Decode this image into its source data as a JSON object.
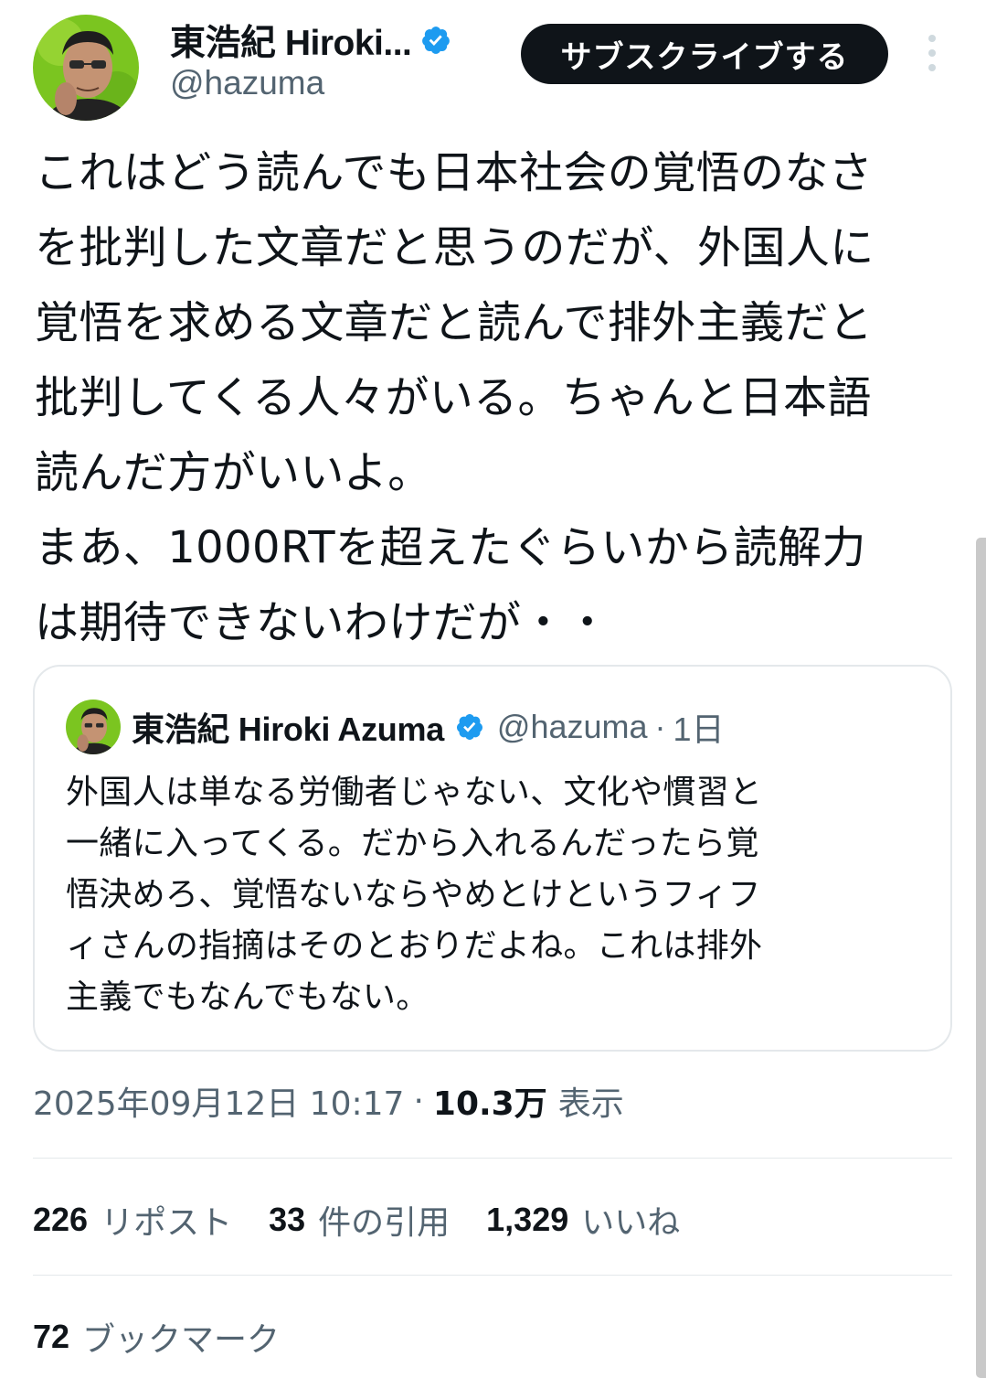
{
  "author": {
    "display_name": "東浩紀 Hiroki...",
    "handle": "@hazuma",
    "verified_icon": "verified-badge-icon",
    "verified_color": "#1d9bf0"
  },
  "header": {
    "subscribe_label": "サブスクライブする",
    "more_icon": "more-vertical-icon"
  },
  "tweet": {
    "lines": [
      "これはどう読んでも日本社会の覚悟のなさ",
      "を批判した文章だと思うのだが、外国人に",
      "覚悟を求める文章だと読んで排外主義だと",
      "批判してくる人々がいる。ちゃんと日本語",
      "読んだ方がいいよ。",
      "まあ、1000RTを超えたぐらいから読解力",
      "は期待できないわけだが・・"
    ]
  },
  "quoted_tweet": {
    "display_name": "東浩紀 Hiroki Azuma",
    "handle": "@hazuma",
    "dot": "·",
    "time": "1日",
    "lines": [
      "外国人は単なる労働者じゃない、文化や慣習と",
      "一緒に入ってくる。だから入れるんだったら覚",
      "悟決めろ、覚悟ないならやめとけというフィフ",
      "ィさんの指摘はそのとおりだよね。これは排外",
      "主義でもなんでもない。"
    ]
  },
  "meta": {
    "timestamp": "2025年09月12日 10:17",
    "separator": "·",
    "views_count": "10.3万",
    "views_label": "表示"
  },
  "stats": {
    "reposts_count": "226",
    "reposts_label": "リポスト",
    "quotes_count": "33",
    "quotes_label": "件の引用",
    "likes_count": "1,329",
    "likes_label": "いいね",
    "bookmarks_count": "72",
    "bookmarks_label": "ブックマーク"
  },
  "colors": {
    "text_primary": "#0f1419",
    "text_secondary": "#536471",
    "border": "#e4e8eb",
    "button_bg": "#0f1419",
    "avatar_bg": "#7bc520"
  }
}
